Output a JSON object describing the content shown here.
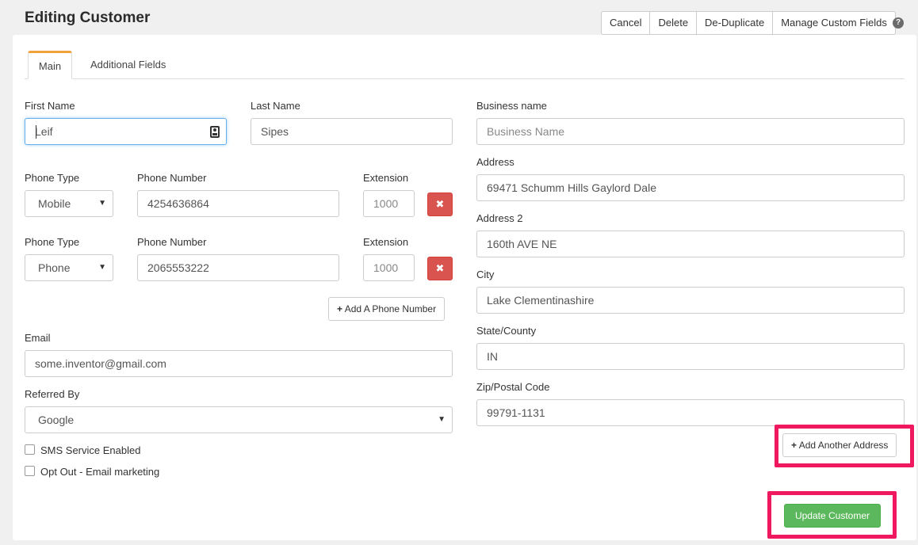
{
  "header": {
    "title": "Editing Customer",
    "actions": [
      "Cancel",
      "Delete",
      "De-Duplicate",
      "Manage Custom Fields"
    ],
    "help": "?"
  },
  "tabs": [
    {
      "label": "Main",
      "active": true
    },
    {
      "label": "Additional Fields",
      "active": false
    }
  ],
  "left": {
    "first_name_label": "First Name",
    "first_name_value": "Leif",
    "last_name_label": "Last Name",
    "last_name_value": "Sipes",
    "phones": [
      {
        "type_label": "Phone Type",
        "type": "Mobile",
        "number_label": "Phone Number",
        "number": "4254636864",
        "ext_label": "Extension",
        "ext_placeholder": "1000",
        "delete": "✖"
      },
      {
        "type_label": "Phone Type",
        "type": "Phone",
        "number_label": "Phone Number",
        "number": "2065553222",
        "ext_label": "Extension",
        "ext_placeholder": "1000",
        "delete": "✖"
      }
    ],
    "add_phone": "Add A Phone Number",
    "email_label": "Email",
    "email_value": "some.inventor@gmail.com",
    "referred_label": "Referred By",
    "referred_value": "Google",
    "sms_label": "SMS Service Enabled",
    "optout_label": "Opt Out - Email marketing"
  },
  "right": {
    "business_label": "Business name",
    "business_placeholder": "Business Name",
    "address_label": "Address",
    "address_value": "69471 Schumm Hills Gaylord Dale",
    "address2_label": "Address 2",
    "address2_value": "160th AVE NE",
    "city_label": "City",
    "city_value": "Lake Clementinashire",
    "state_label": "State/County",
    "state_value": "IN",
    "zip_label": "Zip/Postal Code",
    "zip_value": "99791-1131",
    "add_address": "Add Another Address"
  },
  "footer": {
    "update": "Update Customer"
  },
  "colors": {
    "tab_accent": "#f0a23c",
    "danger": "#d9534f",
    "success": "#5cb85c",
    "highlight": "#f0185f",
    "focus": "#66afe9"
  }
}
